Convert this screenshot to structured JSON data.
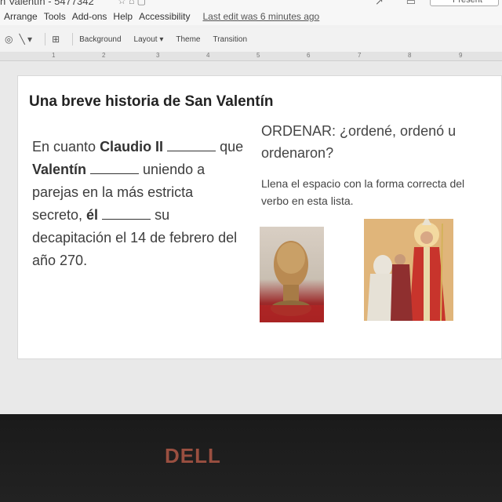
{
  "window": {
    "doc_title": "n Valentín - 5477342",
    "present_label": "Present"
  },
  "menu": {
    "items": [
      "Arrange",
      "Tools",
      "Add-ons",
      "Help",
      "Accessibility"
    ],
    "last_edit": "Last edit was 6 minutes ago"
  },
  "toolbar": {
    "background_label": "Background",
    "layout_label": "Layout ▾",
    "theme_label": "Theme",
    "transition_label": "Transition"
  },
  "ruler": {
    "numbers": [
      "1",
      "2",
      "3",
      "4",
      "5",
      "6",
      "7",
      "8",
      "9"
    ]
  },
  "slide": {
    "title": "Una breve historia de San Valentín",
    "sentence": {
      "p1": "En cuanto ",
      "claudio": "Claudio II",
      "p2": " que ",
      "valentin": "Valentín",
      "p3": " uniendo a parejas en la más estricta secreto, ",
      "el": "él",
      "p4": " su decapitación el 14 de febrero del año 270."
    },
    "ordenar": "ORDENAR: ¿ordené, ordenó u ordenaron?",
    "instructions": "Llena el espacio con la forma correcta del verbo en esta lista."
  },
  "bezel": {
    "brand": "DELL"
  }
}
